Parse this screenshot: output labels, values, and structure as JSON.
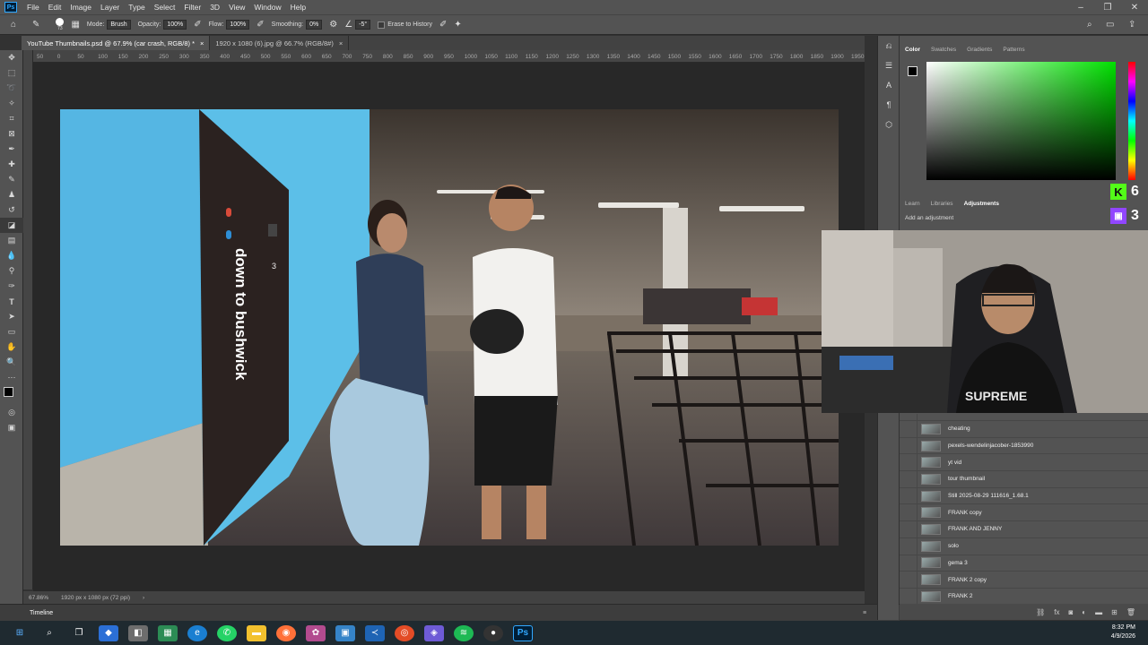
{
  "menubar": {
    "logo": "Ps",
    "items": [
      "File",
      "Edit",
      "Image",
      "Layer",
      "Type",
      "Select",
      "Filter",
      "3D",
      "View",
      "Window",
      "Help"
    ]
  },
  "options": {
    "brush_size": "73",
    "mode_label": "Mode:",
    "mode_value": "Brush",
    "opacity_label": "Opacity:",
    "opacity_value": "100%",
    "flow_label": "Flow:",
    "flow_value": "100%",
    "smoothing_label": "Smoothing:",
    "smoothing_value": "0%",
    "angle_value": "-5°",
    "erase_history_label": "Erase to History"
  },
  "tabs": [
    {
      "label": "YouTube Thumbnails.psd @ 67.9% (car crash, RGB/8) *"
    },
    {
      "label": "1920 x 1080 (6).jpg @ 66.7% (RGB/8#)"
    }
  ],
  "ruler": {
    "ticks": [
      "50",
      "0",
      "50",
      "100",
      "150",
      "200",
      "250",
      "300",
      "350",
      "400",
      "450",
      "500",
      "550",
      "600",
      "650",
      "700",
      "750",
      "800",
      "850",
      "900",
      "950",
      "1000",
      "1050",
      "1100",
      "1150",
      "1200",
      "1250",
      "1300",
      "1350",
      "1400",
      "1450",
      "1500",
      "1550",
      "1600",
      "1650",
      "1700",
      "1750",
      "1800",
      "1850",
      "1900",
      "1950"
    ]
  },
  "canvas": {
    "overlay_text": "down to bushwick",
    "door_number": "3"
  },
  "status": {
    "zoom": "67.86%",
    "doc_size": "1920 px x 1080 px (72 ppi)"
  },
  "timeline": {
    "label": "Timeline"
  },
  "color_panel": {
    "tabs": [
      "Color",
      "Swatches",
      "Gradients",
      "Patterns"
    ],
    "fg_color": "#000000",
    "bg_color": "#ffffff",
    "hue_color": "#00e000"
  },
  "adjust_panel": {
    "tabs": [
      "Learn",
      "Libraries",
      "Adjustments"
    ],
    "hint": "Add an adjustment"
  },
  "layers": [
    {
      "name": "cheating"
    },
    {
      "name": "pexels-wendelinjacober-1853990"
    },
    {
      "name": "yt vid"
    },
    {
      "name": "tour thumbnail"
    },
    {
      "name": "Still 2025-08-29 111616_1.68.1"
    },
    {
      "name": "FRANK copy"
    },
    {
      "name": "FRANK AND JENNY"
    },
    {
      "name": "solo"
    },
    {
      "name": "gema 3"
    },
    {
      "name": "FRANK 2 copy"
    },
    {
      "name": "FRANK 2"
    }
  ],
  "overlay_badges": {
    "kick_count": "6",
    "twitch_count": "3"
  },
  "taskbar": {
    "time": "8:32 PM",
    "date": "4/9/2026"
  }
}
